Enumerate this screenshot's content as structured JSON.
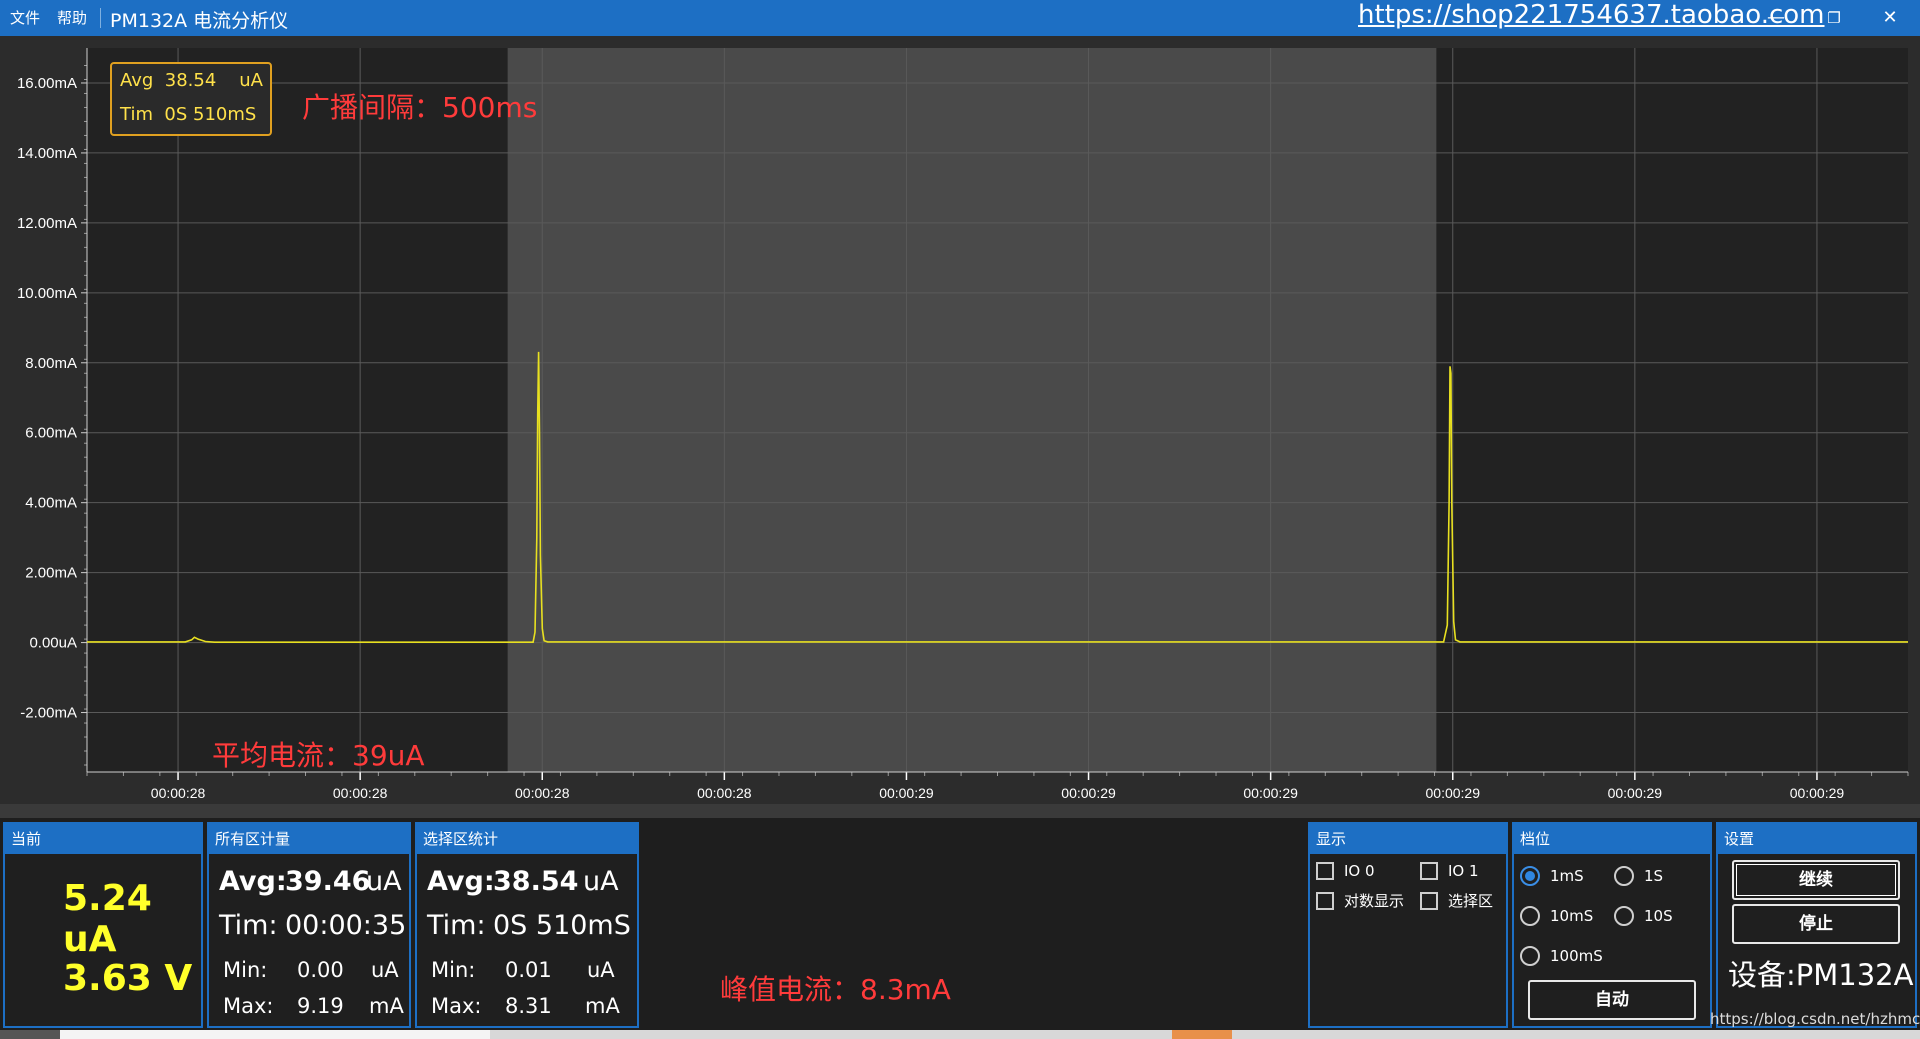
{
  "window": {
    "menu": [
      "文件",
      "帮助"
    ],
    "title": "PM132A 电流分析仪",
    "shop_link": "https://shop221754637.taobao.com",
    "controls": {
      "minimize": "—",
      "restore": "❐",
      "close": "✕"
    }
  },
  "chart": {
    "info_box": {
      "avg_row": "Avg  38.54    uA",
      "tim_row": "Tim  0S 510mS"
    },
    "annotations": {
      "interval": "广播间隔：500ms",
      "avg_current": "平均电流：39uA",
      "peak_current": "峰值电流：8.3mA"
    }
  },
  "chart_data": {
    "type": "line",
    "y_tick_labels": [
      "16.00mA",
      "14.00mA",
      "12.00mA",
      "10.00mA",
      "8.00mA",
      "6.00mA",
      "4.00mA",
      "2.00mA",
      "0.00uA",
      "-2.00mA"
    ],
    "y_ticks_mA": [
      16,
      14,
      12,
      10,
      8,
      6,
      4,
      2,
      0,
      -2
    ],
    "ylim_mA": [
      -3.7,
      17.0
    ],
    "x_tick_labels": [
      "00:00:28",
      "00:00:28",
      "00:00:28",
      "00:00:28",
      "00:00:29",
      "00:00:29",
      "00:00:29",
      "00:00:29",
      "00:00:29",
      "00:00:29"
    ],
    "x_tick_times_ms": [
      100,
      300,
      500,
      700,
      900,
      1100,
      1300,
      1500,
      1700,
      1900
    ],
    "xlim_ms": [
      0,
      2000
    ],
    "selection_ms": [
      462,
      1482
    ],
    "series": [
      {
        "color": "#e8e020",
        "points_ms_mA": [
          [
            0,
            0.02
          ],
          [
            108,
            0.02
          ],
          [
            115,
            0.08
          ],
          [
            118,
            0.15
          ],
          [
            122,
            0.1
          ],
          [
            130,
            0.03
          ],
          [
            140,
            0.01
          ],
          [
            490,
            0.01
          ],
          [
            492,
            0.3
          ],
          [
            494,
            3.0
          ],
          [
            495,
            6.5
          ],
          [
            496,
            8.31
          ],
          [
            497,
            6.0
          ],
          [
            498,
            2.5
          ],
          [
            500,
            0.4
          ],
          [
            502,
            0.05
          ],
          [
            506,
            0.02
          ],
          [
            1490,
            0.02
          ],
          [
            1494,
            0.5
          ],
          [
            1496,
            4.0
          ],
          [
            1497,
            7.9
          ],
          [
            1498,
            7.7
          ],
          [
            1499,
            4.0
          ],
          [
            1501,
            0.6
          ],
          [
            1503,
            0.08
          ],
          [
            1508,
            0.02
          ],
          [
            2000,
            0.02
          ]
        ]
      }
    ],
    "grid": true
  },
  "panels": {
    "current": {
      "header": "当前",
      "current_value": "5.24 uA",
      "voltage_value": "3.63 V"
    },
    "all_stats": {
      "header": "所有区计量",
      "avg_label": "Avg:",
      "avg_value": "39.46",
      "avg_unit": "uA",
      "tim_label": "Tim:",
      "tim_value": "00:00:35",
      "min_label": "Min:",
      "min_value": "0.00",
      "min_unit": "uA",
      "max_label": "Max:",
      "max_value": "9.19",
      "max_unit": "mA"
    },
    "sel_stats": {
      "header": "选择区统计",
      "avg_label": "Avg:",
      "avg_value": "38.54",
      "avg_unit": "uA",
      "tim_label": "Tim:",
      "tim_value": "0S 510mS",
      "min_label": "Min:",
      "min_value": "0.01",
      "min_unit": "uA",
      "max_label": "Max:",
      "max_value": "8.31",
      "max_unit": "mA"
    },
    "display": {
      "header": "显示",
      "io0": "IO 0",
      "io1": "IO 1",
      "log": "对数显示",
      "select": "选择区"
    },
    "range": {
      "header": "档位",
      "r1ms": "1mS",
      "r1s": "1S",
      "r10ms": "10mS",
      "r10s": "10S",
      "r100ms": "100mS",
      "auto": "自动",
      "selected": "1mS"
    },
    "settings": {
      "header": "设置",
      "continue": "继续",
      "stop": "停止",
      "device": "设备:PM132A"
    }
  },
  "watermark": "https://blog.csdn.net/hzhmcu",
  "colors": {
    "accent": "#1d6fc4",
    "trace": "#e8e020",
    "annotation": "#ff3b3b",
    "value": "#ffff2a"
  }
}
